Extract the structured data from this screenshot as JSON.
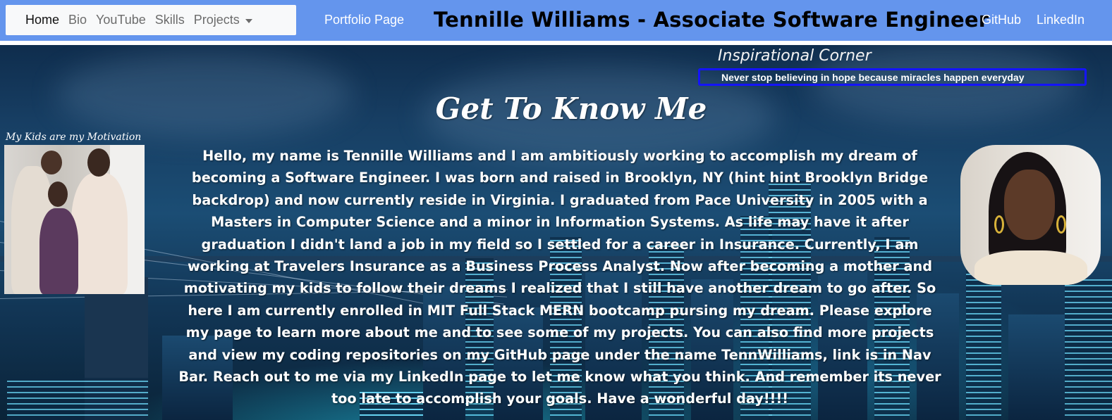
{
  "nav": {
    "items": [
      {
        "label": "Home"
      },
      {
        "label": "Bio"
      },
      {
        "label": "YouTube"
      },
      {
        "label": "Skills"
      },
      {
        "label": "Projects"
      }
    ],
    "portfolio_label": "Portfolio Page",
    "site_title": "Tennille Williams - Associate Software Engineer",
    "github_label": "GitHub",
    "linkedin_label": "LinkedIn"
  },
  "inspirational": {
    "title": "Inspirational Corner",
    "quote": "Never stop believing in hope because miracles happen everyday"
  },
  "main": {
    "heading": "Get To Know Me",
    "kids_caption": "My Kids are my Motivation",
    "bio": "Hello, my name is Tennille Williams and I am ambitiously working to accomplish my dream of becoming a Software Engineer. I was born and raised in Brooklyn, NY (hint hint Brooklyn Bridge backdrop) and now currently reside in Virginia. I graduated from Pace University in 2005 with a Masters in Computer Science and a minor in Information Systems. As life may have it after graduation I didn't land a job in my field so I settled for a career in Insurance. Currently, I am working at Travelers Insurance as a Business Process Analyst. Now after becoming a mother and motivating my kids to follow their dreams I realized that I still have another dream to go after. So here I am currently enrolled in MIT Full Stack MERN bootcamp pursing my dream. Please explore my page to learn more about me and to see some of my projects. You can also find more projects and view my coding repositories on my GitHub page under the name TennWilliams, link is in Nav Bar. Reach out to me via my LinkedIn page to let me know what you think. And remember its never too late to accomplish your goals. Have a wonderful day!!!!"
  },
  "colors": {
    "navbar": "#6495ed",
    "quote_border": "#1414ff"
  }
}
